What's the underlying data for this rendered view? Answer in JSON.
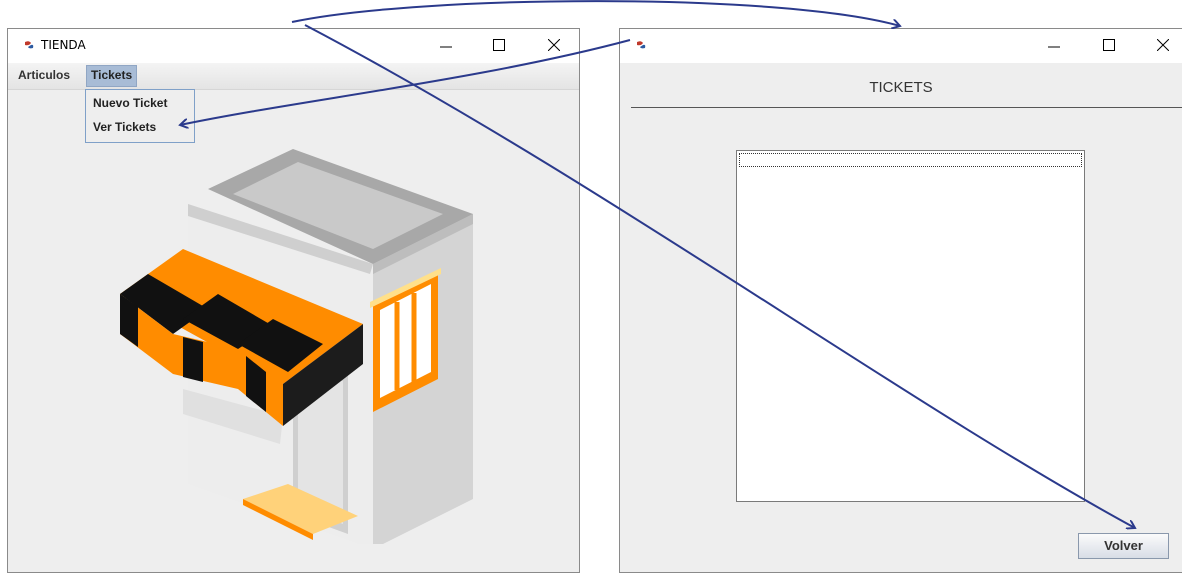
{
  "left_window": {
    "title": "TIENDA",
    "menus": [
      {
        "label": "Articulos",
        "active": false
      },
      {
        "label": "Tickets",
        "active": true
      }
    ],
    "dropdown": [
      "Nuevo Ticket",
      "Ver Tickets"
    ],
    "image": "shop-storefront-icon"
  },
  "right_window": {
    "title": "",
    "header": "TICKETS",
    "list_items": [
      ""
    ],
    "button_label": "Volver"
  },
  "colors": {
    "arrow": "#2b3a8c",
    "awning_orange": "#ff8c00",
    "awning_black": "#111111",
    "menu_highlight": "#a8bcd6"
  }
}
